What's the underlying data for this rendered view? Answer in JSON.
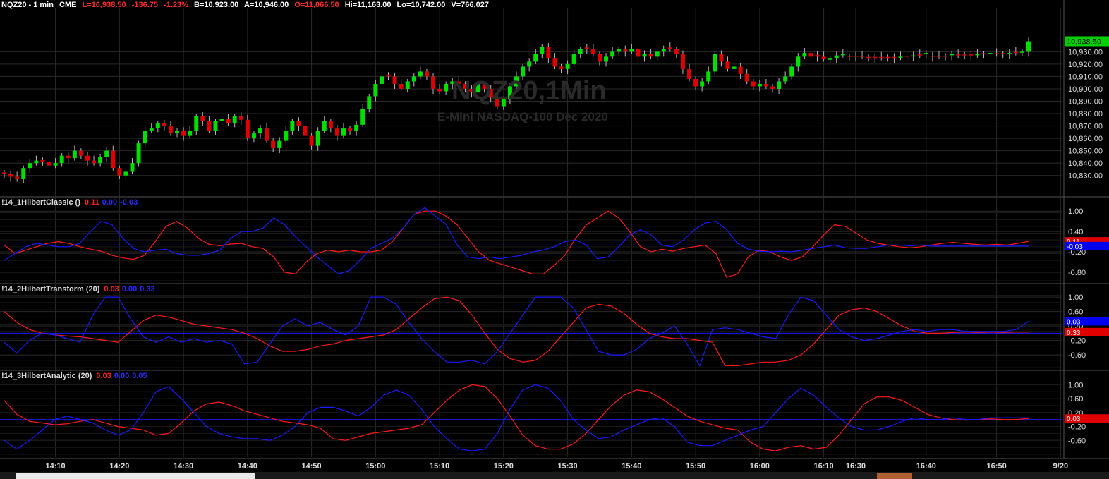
{
  "header": {
    "symbol": "NQZ20 - 1 min",
    "exchange": "CME",
    "last": "L=10,938.50",
    "change": "-136.75",
    "change_pct": "-1.23%",
    "bid": "B=10,923.00",
    "ask": "A=10,946.00",
    "open": "O=11,066.50",
    "high": "Hi=11,163.00",
    "low": "Lo=10,742.00",
    "volume": "V=766,027"
  },
  "watermark": {
    "symbol": "NQZ20,1Min",
    "description": "E-Mini NASDAQ-100 Dec 2020"
  },
  "indicators": [
    {
      "name": "!14_1HilbertClassic ()",
      "v1": "0.11",
      "v2": "0.00",
      "v3": "-0.03"
    },
    {
      "name": "!14_2HilbertTransform (20)",
      "v1": "0.03",
      "v2": "0.00",
      "v3": "0.33"
    },
    {
      "name": "!14_3HilbertAnalytic (20)",
      "v1": "0.03",
      "v2": "0.00",
      "v3": "0.05"
    }
  ],
  "colors": {
    "up": "#00e000",
    "down": "#e00000",
    "red_line": "#ff1a1a",
    "blue_line": "#1a1aff",
    "grid": "#2a2a2a"
  },
  "chart_data": [
    {
      "type": "candlestick",
      "title": "NQZ20,1Min",
      "ylim": [
        10815,
        10965
      ],
      "y_ticks": [
        "10,930.00",
        "10,920.00",
        "10,910.00",
        "10,900.00",
        "10,890.00",
        "10,880.00",
        "10,870.00",
        "10,860.00",
        "10,850.00",
        "10,840.00",
        "10,830.00"
      ],
      "y_tick_values": [
        10930,
        10920,
        10910,
        10900,
        10890,
        10880,
        10870,
        10860,
        10850,
        10840,
        10830
      ],
      "last_label": "10,938.50",
      "last_value": 10938.5,
      "x_ticks": [
        "14:10",
        "14:20",
        "14:30",
        "14:40",
        "14:50",
        "15:00",
        "15:10",
        "15:20",
        "15:30",
        "15:40",
        "15:50",
        "16:00",
        "16:10",
        "16:30",
        "16:40",
        "16:50",
        "9/20"
      ],
      "x_tick_index": [
        8,
        18,
        28,
        38,
        48,
        58,
        68,
        78,
        88,
        98,
        108,
        118,
        128,
        133,
        144,
        155,
        165
      ],
      "close": [
        10831,
        10829,
        10827,
        10836,
        10840,
        10842,
        10841,
        10838,
        10840,
        10846,
        10844,
        10850,
        10846,
        10842,
        10840,
        10845,
        10850,
        10836,
        10830,
        10833,
        10840,
        10856,
        10866,
        10868,
        10872,
        10870,
        10864,
        10866,
        10862,
        10866,
        10878,
        10874,
        10866,
        10874,
        10876,
        10872,
        10878,
        10875,
        10860,
        10864,
        10868,
        10858,
        10852,
        10858,
        10866,
        10874,
        10870,
        10862,
        10854,
        10866,
        10874,
        10868,
        10862,
        10868,
        10866,
        10871,
        10884,
        10894,
        10904,
        10910,
        10910,
        10904,
        10900,
        10906,
        10910,
        10914,
        10910,
        10900,
        10898,
        10904,
        10906,
        10904,
        10900,
        10897,
        10904,
        10900,
        10893,
        10886,
        10892,
        10902,
        10910,
        10918,
        10922,
        10928,
        10934,
        10925,
        10918,
        10916,
        10920,
        10928,
        10932,
        10932,
        10928,
        10922,
        10926,
        10930,
        10932,
        10930,
        10932,
        10926,
        10928,
        10926,
        10930,
        10932,
        10932,
        10928,
        10916,
        10908,
        10902,
        10906,
        10914,
        10928,
        10922,
        10916,
        10918,
        10912,
        10906,
        10902,
        10904,
        10902,
        10900,
        10906,
        10910,
        10918,
        10926,
        10929,
        10926,
        10926,
        10924,
        10925,
        10927,
        10928,
        10926,
        10926,
        10926,
        10925,
        10925,
        10925,
        10925,
        10925,
        10926,
        10926,
        10927,
        10927,
        10929,
        10926,
        10926,
        10926,
        10928,
        10927,
        10927,
        10927,
        10928,
        10928,
        10929,
        10928,
        10928,
        10929,
        10929,
        10930,
        10938.5
      ],
      "up": [
        0,
        0,
        0,
        1,
        1,
        1,
        0,
        0,
        1,
        1,
        0,
        1,
        0,
        0,
        0,
        1,
        1,
        0,
        0,
        1,
        1,
        1,
        1,
        1,
        1,
        0,
        0,
        1,
        0,
        1,
        1,
        0,
        0,
        1,
        1,
        0,
        1,
        0,
        0,
        1,
        1,
        0,
        0,
        1,
        1,
        1,
        0,
        0,
        0,
        1,
        1,
        0,
        0,
        1,
        0,
        1,
        1,
        1,
        1,
        1,
        0,
        0,
        0,
        1,
        1,
        1,
        0,
        0,
        0,
        1,
        1,
        0,
        0,
        0,
        1,
        0,
        0,
        0,
        1,
        1,
        1,
        1,
        1,
        1,
        1,
        0,
        0,
        0,
        1,
        1,
        1,
        0,
        0,
        0,
        1,
        1,
        1,
        0,
        1,
        0,
        1,
        0,
        1,
        1,
        0,
        0,
        0,
        0,
        0,
        1,
        1,
        1,
        0,
        0,
        1,
        0,
        0,
        0,
        1,
        0,
        0,
        1,
        1,
        1,
        1,
        1,
        0,
        0,
        0,
        1,
        1,
        1,
        0,
        0,
        0,
        0,
        0,
        0,
        0,
        0,
        1,
        0,
        1,
        0,
        1,
        0,
        0,
        0,
        1,
        0,
        0,
        0,
        1,
        0,
        1,
        0,
        0,
        1,
        0,
        1,
        1
      ]
    },
    {
      "type": "line",
      "name": "!14_1HilbertClassic ()",
      "ylim": [
        -1.05,
        1.15
      ],
      "y_ticks": [
        "1.00",
        "0.40",
        "-0.20",
        "-0.80"
      ],
      "y_tick_values": [
        1.0,
        0.4,
        -0.2,
        -0.8
      ],
      "last_labels": [
        "0.11",
        "-0.03"
      ],
      "series": [
        {
          "color": "red",
          "values": [
            0.0,
            -0.25,
            -0.15,
            -0.05,
            0.05,
            0.1,
            0.05,
            -0.05,
            -0.12,
            -0.18,
            -0.3,
            -0.38,
            -0.42,
            -0.3,
            0.1,
            0.55,
            0.7,
            0.5,
            0.2,
            0.02,
            -0.02,
            0.03,
            0.05,
            -0.05,
            -0.1,
            -0.35,
            -0.8,
            -0.85,
            -0.5,
            -0.25,
            -0.15,
            -0.2,
            -0.15,
            -0.2,
            -0.2,
            -0.15,
            0.1,
            0.5,
            0.9,
            1.0,
            1.0,
            0.85,
            0.6,
            0.2,
            -0.2,
            -0.45,
            -0.55,
            -0.65,
            -0.75,
            -0.85,
            -0.85,
            -0.6,
            -0.3,
            0.2,
            0.6,
            0.8,
            1.0,
            0.8,
            0.4,
            -0.05,
            -0.2,
            -0.12,
            -0.18,
            -0.1,
            -0.05,
            0.0,
            -0.25,
            -0.95,
            -0.85,
            -0.35,
            -0.15,
            -0.2,
            -0.35,
            -0.45,
            -0.35,
            -0.05,
            0.3,
            0.6,
            0.55,
            0.35,
            0.15,
            0.05,
            0.0,
            -0.05,
            -0.08,
            -0.05,
            0.0,
            0.05,
            0.08,
            0.05,
            0.02,
            0.0,
            0.02,
            0.0,
            0.05,
            0.11
          ]
        },
        {
          "color": "blue",
          "values": [
            -0.45,
            -0.25,
            -0.05,
            0.05,
            0.0,
            -0.05,
            -0.05,
            0.05,
            0.4,
            0.7,
            0.6,
            0.2,
            -0.1,
            -0.2,
            -0.15,
            -0.12,
            -0.25,
            -0.3,
            -0.3,
            -0.25,
            -0.15,
            0.2,
            0.4,
            0.4,
            0.5,
            0.8,
            0.6,
            0.25,
            -0.05,
            -0.35,
            -0.6,
            -0.85,
            -0.75,
            -0.45,
            -0.1,
            0.05,
            0.2,
            0.5,
            0.9,
            1.1,
            0.85,
            0.6,
            0.0,
            -0.35,
            -0.4,
            -0.35,
            -0.4,
            -0.35,
            -0.3,
            -0.2,
            -0.15,
            -0.05,
            0.1,
            0.15,
            0.0,
            -0.4,
            -0.35,
            -0.05,
            0.3,
            0.45,
            0.3,
            0.0,
            -0.05,
            0.15,
            0.45,
            0.65,
            0.7,
            0.45,
            0.05,
            -0.12,
            -0.18,
            -0.2,
            -0.18,
            -0.2,
            -0.15,
            -0.1,
            -0.05,
            0.0,
            -0.08,
            -0.1,
            -0.1,
            -0.05,
            0.0,
            0.0,
            -0.02,
            0.0,
            -0.03,
            -0.03,
            -0.03,
            -0.03,
            -0.03,
            -0.03,
            -0.03,
            -0.03,
            -0.03,
            -0.03
          ]
        }
      ]
    },
    {
      "type": "line",
      "name": "!14_2HilbertTransform (20)",
      "ylim": [
        -0.95,
        1.12
      ],
      "y_ticks": [
        "1.00",
        "0.60",
        "0.20",
        "-0.20",
        "-0.60"
      ],
      "y_tick_values": [
        1.0,
        0.6,
        0.2,
        -0.2,
        -0.6
      ],
      "last_labels": [
        "0.33",
        "0.03"
      ],
      "series": [
        {
          "color": "red",
          "values": [
            0.6,
            0.3,
            0.1,
            0.0,
            -0.05,
            -0.08,
            -0.1,
            -0.15,
            -0.2,
            -0.25,
            0.05,
            0.35,
            0.5,
            0.45,
            0.35,
            0.25,
            0.2,
            0.15,
            0.1,
            0.0,
            -0.15,
            -0.35,
            -0.5,
            -0.5,
            -0.45,
            -0.35,
            -0.3,
            -0.2,
            -0.15,
            -0.1,
            -0.05,
            0.1,
            0.4,
            0.7,
            0.95,
            1.0,
            0.9,
            0.5,
            0.0,
            -0.45,
            -0.7,
            -0.8,
            -0.75,
            -0.5,
            -0.1,
            0.3,
            0.7,
            0.8,
            0.75,
            0.55,
            0.25,
            0.0,
            -0.1,
            -0.15,
            -0.15,
            -0.2,
            -0.25,
            -0.9,
            -0.9,
            -0.85,
            -0.8,
            -0.8,
            -0.75,
            -0.6,
            -0.3,
            0.1,
            0.5,
            0.65,
            0.7,
            0.6,
            0.4,
            0.2,
            0.05,
            0.0,
            0.0,
            0.02,
            0.03,
            0.02,
            0.03,
            0.02,
            0.03,
            0.03
          ]
        },
        {
          "color": "blue",
          "values": [
            -0.25,
            -0.55,
            -0.2,
            0.0,
            -0.05,
            -0.15,
            -0.25,
            0.5,
            1.0,
            1.0,
            0.4,
            -0.1,
            -0.25,
            -0.1,
            -0.25,
            -0.15,
            -0.25,
            -0.2,
            -0.3,
            -0.85,
            -0.8,
            -0.3,
            0.2,
            0.4,
            0.2,
            0.3,
            0.1,
            -0.05,
            0.2,
            1.0,
            1.0,
            0.8,
            0.3,
            -0.15,
            -0.5,
            -0.8,
            -0.8,
            -0.75,
            -0.85,
            -0.5,
            0.0,
            0.5,
            1.0,
            1.0,
            1.0,
            0.7,
            0.1,
            -0.5,
            -0.6,
            -0.6,
            -0.45,
            -0.15,
            0.0,
            0.2,
            -0.3,
            -0.9,
            0.1,
            0.15,
            0.1,
            0.0,
            -0.1,
            -0.15,
            0.5,
            1.0,
            0.9,
            0.5,
            0.1,
            -0.1,
            -0.2,
            -0.15,
            -0.05,
            0.05,
            0.1,
            0.05,
            0.1,
            0.1,
            0.05,
            0.05,
            0.05,
            0.05,
            0.1,
            0.33
          ]
        }
      ]
    },
    {
      "type": "line",
      "name": "!14_3HilbertAnalytic (20)",
      "ylim": [
        -1.0,
        1.15
      ],
      "y_ticks": [
        "1.00",
        "0.60",
        "0.20",
        "-0.20",
        "-0.60"
      ],
      "y_tick_values": [
        1.0,
        0.6,
        0.2,
        -0.2,
        -0.6
      ],
      "last_labels": [
        "0.03"
      ],
      "series": [
        {
          "color": "red",
          "values": [
            0.55,
            0.15,
            -0.05,
            -0.1,
            -0.15,
            -0.12,
            -0.05,
            0.0,
            -0.1,
            -0.2,
            -0.25,
            -0.3,
            -0.45,
            -0.4,
            -0.1,
            0.25,
            0.45,
            0.5,
            0.4,
            0.25,
            0.15,
            0.05,
            -0.05,
            -0.1,
            -0.15,
            -0.25,
            -0.55,
            -0.6,
            -0.5,
            -0.4,
            -0.35,
            -0.3,
            -0.25,
            -0.15,
            0.2,
            0.55,
            0.85,
            1.0,
            0.95,
            0.6,
            0.1,
            -0.45,
            -0.75,
            -0.85,
            -0.85,
            -0.7,
            -0.4,
            0.0,
            0.4,
            0.7,
            0.85,
            0.8,
            0.6,
            0.35,
            0.1,
            -0.05,
            -0.15,
            -0.25,
            -0.3,
            -0.65,
            -0.85,
            -0.9,
            -0.8,
            -0.75,
            -0.85,
            -0.8,
            -0.45,
            0.0,
            0.45,
            0.65,
            0.65,
            0.55,
            0.35,
            0.15,
            0.05,
            0.0,
            -0.02,
            0.0,
            0.02,
            0.0,
            0.0,
            0.03
          ]
        },
        {
          "color": "blue",
          "values": [
            -0.6,
            -0.85,
            -0.6,
            -0.3,
            0.0,
            0.1,
            0.0,
            -0.1,
            -0.3,
            -0.45,
            -0.3,
            0.2,
            0.8,
            0.95,
            0.6,
            0.2,
            -0.2,
            -0.4,
            -0.5,
            -0.55,
            -0.55,
            -0.6,
            -0.45,
            -0.2,
            0.2,
            0.35,
            0.35,
            0.25,
            0.1,
            0.35,
            0.7,
            0.85,
            0.7,
            0.3,
            -0.2,
            -0.55,
            -0.85,
            -0.9,
            -0.85,
            -0.4,
            0.3,
            0.85,
            1.0,
            0.9,
            0.55,
            0.0,
            -0.3,
            -0.55,
            -0.5,
            -0.3,
            -0.15,
            0.0,
            0.05,
            -0.2,
            -0.65,
            -0.75,
            -0.75,
            -0.6,
            -0.45,
            -0.3,
            -0.2,
            0.2,
            0.6,
            0.9,
            0.7,
            0.35,
            0.05,
            -0.2,
            -0.3,
            -0.3,
            -0.2,
            -0.05,
            0.05,
            0.0,
            0.0,
            0.05,
            0.0,
            0.0,
            0.05,
            0.05,
            0.05,
            0.05
          ]
        }
      ]
    }
  ]
}
